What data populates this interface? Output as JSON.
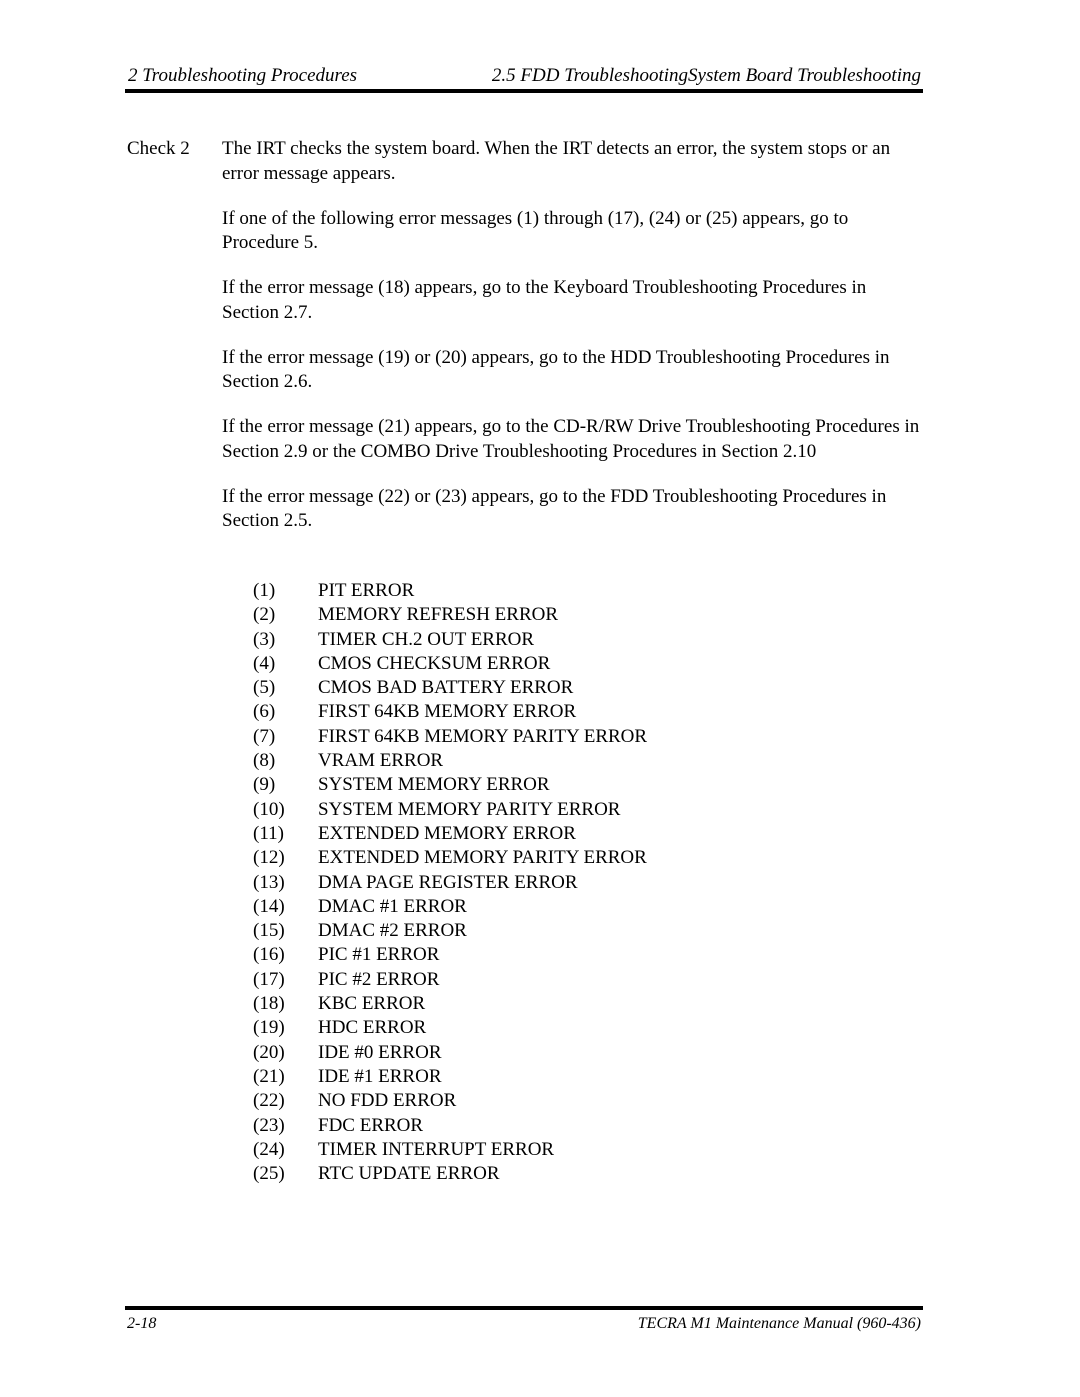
{
  "header": {
    "chapter": "2  Troubleshooting Procedures",
    "section": "2.5 FDD TroubleshootingSystem Board Troubleshooting"
  },
  "check": {
    "label": "Check 2",
    "paragraphs": [
      "The IRT checks the system board. When the IRT detects an error, the system stops or an error message appears.",
      "If one of the following error messages (1) through (17), (24) or (25) appears, go to Procedure 5.",
      "If the error message (18) appears, go to the Keyboard Troubleshooting Procedures in Section 2.7.",
      "If the error message (19) or (20) appears, go to the HDD Troubleshooting Procedures in Section 2.6.",
      "If the error message (21) appears, go to the CD-R/RW Drive Troubleshooting Procedures in Section 2.9 or the COMBO Drive Troubleshooting Procedures in Section 2.10",
      "If the error message (22) or (23) appears, go to the FDD Troubleshooting Procedures in Section 2.5."
    ]
  },
  "errors": [
    {
      "num": "(1)",
      "text": "PIT ERROR"
    },
    {
      "num": "(2)",
      "text": "MEMORY REFRESH ERROR"
    },
    {
      "num": "(3)",
      "text": "TIMER CH.2 OUT ERROR"
    },
    {
      "num": "(4)",
      "text": "CMOS CHECKSUM ERROR"
    },
    {
      "num": "(5)",
      "text": "CMOS BAD BATTERY ERROR"
    },
    {
      "num": "(6)",
      "text": "FIRST 64KB MEMORY ERROR"
    },
    {
      "num": "(7)",
      "text": "FIRST 64KB MEMORY PARITY ERROR"
    },
    {
      "num": "(8)",
      "text": "VRAM ERROR"
    },
    {
      "num": "(9)",
      "text": "SYSTEM MEMORY ERROR"
    },
    {
      "num": "(10)",
      "text": "SYSTEM MEMORY PARITY ERROR"
    },
    {
      "num": "(11)",
      "text": "EXTENDED MEMORY ERROR"
    },
    {
      "num": "(12)",
      "text": "EXTENDED MEMORY PARITY ERROR"
    },
    {
      "num": "(13)",
      "text": "DMA PAGE REGISTER ERROR"
    },
    {
      "num": "(14)",
      "text": "DMAC #1 ERROR"
    },
    {
      "num": "(15)",
      "text": "DMAC #2 ERROR"
    },
    {
      "num": "(16)",
      "text": "PIC #1 ERROR"
    },
    {
      "num": "(17)",
      "text": "PIC #2 ERROR"
    },
    {
      "num": "(18)",
      "text": "KBC ERROR"
    },
    {
      "num": "(19)",
      "text": "HDC ERROR"
    },
    {
      "num": "(20)",
      "text": "IDE #0 ERROR"
    },
    {
      "num": "(21)",
      "text": "IDE #1 ERROR"
    },
    {
      "num": "(22)",
      "text": "NO FDD ERROR"
    },
    {
      "num": "(23)",
      "text": "FDC ERROR"
    },
    {
      "num": "(24)",
      "text": "TIMER INTERRUPT ERROR"
    },
    {
      "num": "(25)",
      "text": "RTC UPDATE ERROR"
    }
  ],
  "footer": {
    "page_number": "2-18",
    "manual_title": "TECRA M1 Maintenance Manual (960-436)"
  }
}
